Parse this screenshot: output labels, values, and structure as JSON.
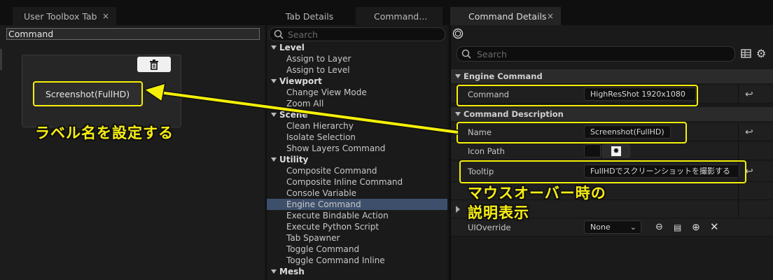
{
  "tabs": {
    "user_toolbox": "User Toolbox Tab",
    "tab_details": "Tab Details",
    "command_short": "Command...",
    "command_details": "Command Details",
    "close_glyph": "×"
  },
  "left": {
    "command_field": "Command",
    "screenshot_button": "Screenshot(FullHD)",
    "annotation": "ラベル名を設定する"
  },
  "mid": {
    "search_placeholder": "Search",
    "tree": [
      {
        "label": "Level",
        "category": true
      },
      {
        "label": "Assign to Layer"
      },
      {
        "label": "Assign to Level"
      },
      {
        "label": "Viewport",
        "category": true
      },
      {
        "label": "Change View Mode"
      },
      {
        "label": "Zoom All"
      },
      {
        "label": "Scene",
        "category": true
      },
      {
        "label": "Clean Hierarchy"
      },
      {
        "label": "Isolate Selection"
      },
      {
        "label": "Show Layers Command"
      },
      {
        "label": "Utility",
        "category": true
      },
      {
        "label": "Composite Command"
      },
      {
        "label": "Composite Inline Command"
      },
      {
        "label": "Console Variable"
      },
      {
        "label": "Engine Command",
        "selected": true
      },
      {
        "label": "Execute Bindable Action"
      },
      {
        "label": "Execute Python Script"
      },
      {
        "label": "Tab Spawner"
      },
      {
        "label": "Toggle Command"
      },
      {
        "label": "Toggle Command Inline"
      },
      {
        "label": "Mesh",
        "category": true
      }
    ]
  },
  "right": {
    "search_placeholder": "Search",
    "section_engine": "Engine Command",
    "section_description": "Command Description",
    "command_label": "Command",
    "command_value": "HighResShot 1920x1080",
    "name_label": "Name",
    "name_value": "Screenshot(FullHD)",
    "icon_path_label": "Icon Path",
    "tooltip_label": "Tooltip",
    "tooltip_value": "FullHDでスクリーンショットを撮影する",
    "uioverride_label": "UIOverride",
    "uioverride_value": "None",
    "annotation_line1": "マウスオーバー時の",
    "annotation_line2": "説明表示"
  },
  "colors": {
    "highlight": "#f5f008",
    "selection": "#3d4f6b"
  }
}
